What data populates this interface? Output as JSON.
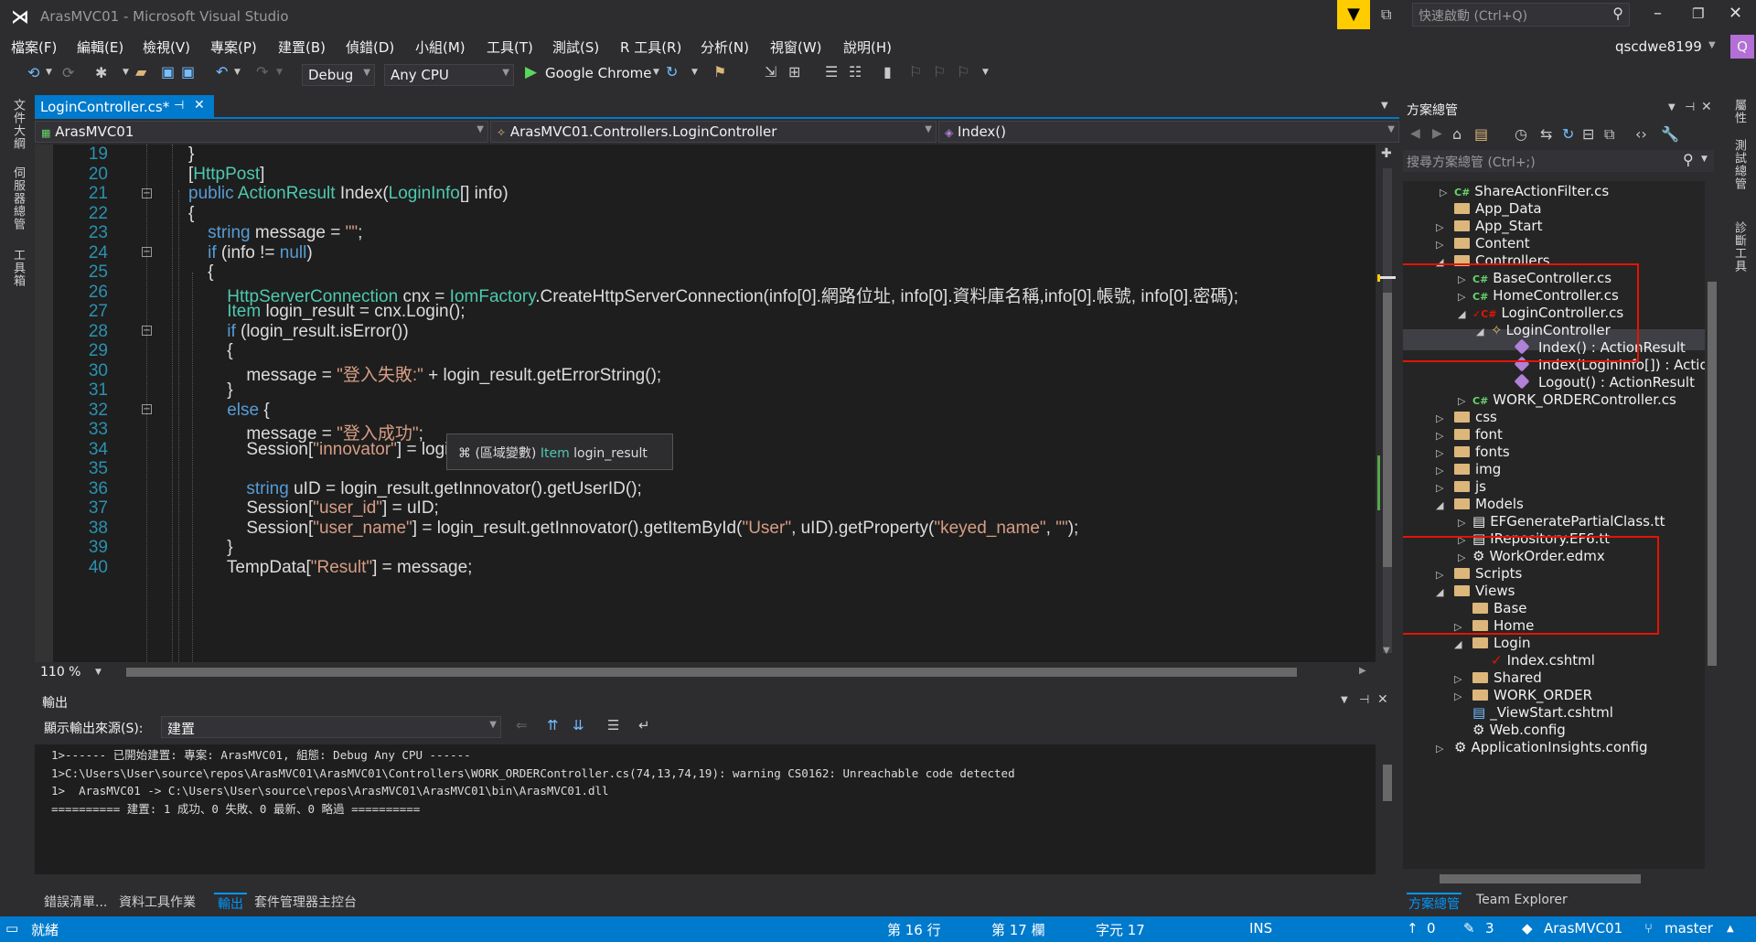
{
  "window": {
    "title": "ArasMVC01 - Microsoft Visual Studio",
    "quick_launch_placeholder": "快速啟動 (Ctrl+Q)",
    "user": "qscdwe8199",
    "avatar_letter": "Q"
  },
  "menu": [
    "檔案(F)",
    "編輯(E)",
    "檢視(V)",
    "專案(P)",
    "建置(B)",
    "偵錯(D)",
    "小組(M)",
    "工具(T)",
    "測試(S)",
    "R 工具(R)",
    "分析(N)",
    "視窗(W)",
    "說明(H)"
  ],
  "toolbar": {
    "config": "Debug",
    "platform": "Any CPU",
    "run_target": "Google Chrome"
  },
  "left_tabs": [
    "文件大綱",
    "伺服器總管",
    "工具箱"
  ],
  "right_tabs": [
    "屬性",
    "測試總管",
    "診斷工具"
  ],
  "editor": {
    "tab_label": "LoginController.cs*",
    "nav_project": "ArasMVC01",
    "nav_class": "ArasMVC01.Controllers.LoginController",
    "nav_member": "Index()",
    "zoom": "110 %",
    "tooltip_prefix": "(區域變數)",
    "tooltip_type": "Item",
    "tooltip_name": "login_result",
    "line_numbers": [
      "19",
      "20",
      "21",
      "22",
      "23",
      "24",
      "25",
      "26",
      "27",
      "28",
      "29",
      "30",
      "31",
      "32",
      "33",
      "34",
      "35",
      "36",
      "37",
      "38",
      "39",
      "40"
    ]
  },
  "output": {
    "title": "輸出",
    "source_label": "顯示輸出來源(S):",
    "source_value": "建置",
    "lines": [
      "1>------ 已開始建置: 專案: ArasMVC01, 組態: Debug Any CPU ------",
      "1>C:\\Users\\User\\source\\repos\\ArasMVC01\\ArasMVC01\\Controllers\\WORK_ORDERController.cs(74,13,74,19): warning CS0162: Unreachable code detected",
      "1>  ArasMVC01 -> C:\\Users\\User\\source\\repos\\ArasMVC01\\ArasMVC01\\bin\\ArasMVC01.dll",
      "========== 建置: 1 成功、0 失敗、0 最新、0 略過 =========="
    ]
  },
  "bottom_tabs": [
    "錯誤清單...",
    "資料工具作業",
    "輸出",
    "套件管理器主控台"
  ],
  "solution": {
    "title": "方案總管",
    "search_placeholder": "搜尋方案總管 (Ctrl+;)",
    "items": [
      "ShareActionFilter.cs",
      "App_Data",
      "App_Start",
      "Content",
      "Controllers",
      "BaseController.cs",
      "HomeController.cs",
      "LoginController.cs",
      "LoginController",
      "Index() : ActionResult",
      "Index(LoginInfo[]) : Actio",
      "Logout() : ActionResult",
      "WORK_ORDERController.cs",
      "css",
      "font",
      "fonts",
      "img",
      "js",
      "Models",
      "EFGeneratePartialClass.tt",
      "IRepository.EF6.tt",
      "WorkOrder.edmx",
      "Scripts",
      "Views",
      "Base",
      "Home",
      "Login",
      "Index.cshtml",
      "Shared",
      "WORK_ORDER",
      "_ViewStart.cshtml",
      "Web.config",
      "ApplicationInsights.config"
    ],
    "tabs": [
      "方案總管",
      "Team Explorer"
    ]
  },
  "status": {
    "ready": "就緒",
    "line": "第 16 行",
    "col": "第 17 欄",
    "ch": "字元 17",
    "ins": "INS",
    "up": "0",
    "pencil": "3",
    "repo": "ArasMVC01",
    "branch": "master"
  }
}
